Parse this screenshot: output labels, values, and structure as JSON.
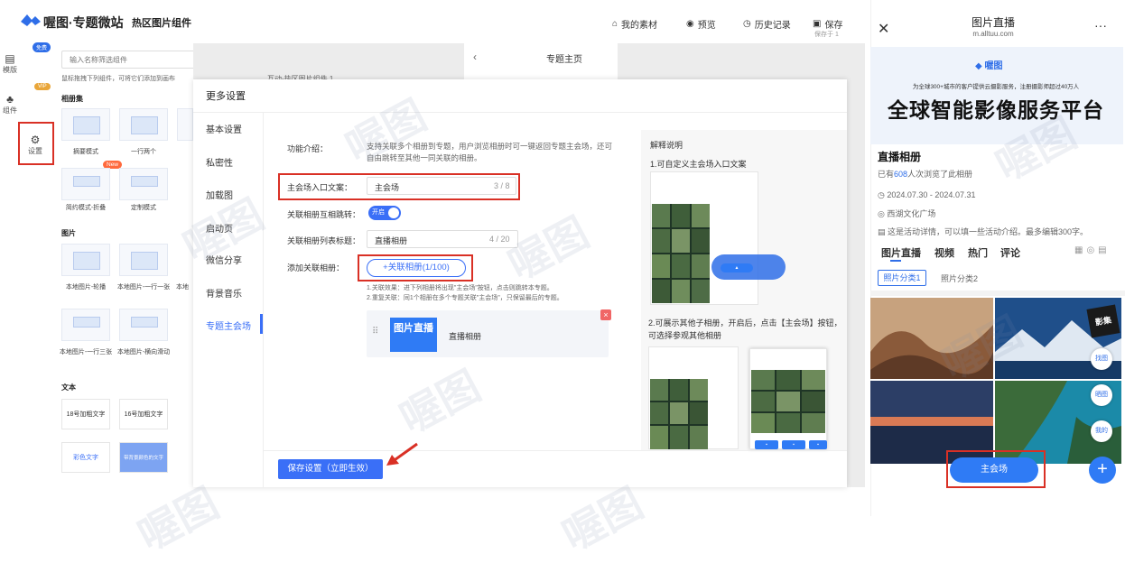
{
  "header": {
    "brand": "喔图·专题微站",
    "subtitle": "热区图片组件",
    "my_assets": "我的素材",
    "preview": "预览",
    "history": "历史记录",
    "save": "保存",
    "save_sub": "保存于 1"
  },
  "rail": {
    "free_badge": "免费",
    "template": "模版",
    "vip_badge": "VIP",
    "components": "组件",
    "settings": "设置"
  },
  "components": {
    "search_placeholder": "输入名称筛选组件",
    "hint": "鼠标拖拽下列组件，可将它们添加到画布",
    "album_section": "相册集",
    "album_items": [
      "摘要模式",
      "一行两个",
      "简约模式-折叠",
      "定制模式"
    ],
    "new_badge": "New",
    "image_section": "图片",
    "image_items": [
      "本地图片-轮播",
      "本地图片-一行一张",
      "本地图片-一行三张",
      "本地图片-横向滑动",
      "本地"
    ],
    "text_section": "文本",
    "text_items": [
      "18号加粗文字",
      "16号加粗文字",
      "彩色文字",
      "带背景颜色的文字"
    ]
  },
  "canvas": {
    "page_title": "专题主页",
    "hotspot_label": "互动-热区图片组件 1"
  },
  "modal": {
    "title": "更多设置",
    "nav": [
      "基本设置",
      "私密性",
      "加载图",
      "启动页",
      "微信分享",
      "背景音乐",
      "专题主会场"
    ],
    "intro_label": "功能介绍：",
    "intro_text": "支持关联多个相册到专题，用户浏览相册时可一键返回专题主会场，还可自由跳转至其他一同关联的相册。",
    "entry_label": "主会场入口文案：",
    "entry_value": "主会场",
    "entry_count": "3 / 8",
    "mutual_label": "关联相册互相跳转：",
    "toggle_text": "开启",
    "list_title_label": "关联相册列表标题：",
    "list_title_value": "直播相册",
    "list_title_count": "4 / 20",
    "add_label": "添加关联相册：",
    "add_button": "+关联相册(1/100)",
    "note1": "1.关联效果：进下列相册将出现\"主会场\"按钮，点击则跳转本专题。",
    "note2": "2.重复关联：同1个相册在多个专题关联\"主会场\"，只保留最后的专题。",
    "album_thumb_text": "图片直播",
    "album_name": "直播相册",
    "remove": "×",
    "explain_title": "解释说明",
    "explain_1": "1.可自定义主会场入口文案",
    "explain_2": "2.可展示其他子相册，开启后，点击【主会场】按钮，可选择参观其他相册",
    "save_button": "保存设置（立即生效）"
  },
  "mobile": {
    "title": "图片直播",
    "url": "m.alltuu.com",
    "banner_logo": "喔图",
    "banner_sub": "为全球300+城市的客户提供云摄影服务，注册摄影师超过40万人",
    "banner_main": "全球智能影像服务平台",
    "album_title": "直播相册",
    "viewers_prefix": "已有",
    "viewers_count": "608",
    "viewers_suffix": "人次浏览了此相册",
    "date": "2024.07.30 - 2024.07.31",
    "location": "西湖文化广场",
    "desc": "这是活动详情，可以填一些活动介绍。最多编辑300字。",
    "tabs": [
      "图片直播",
      "视频",
      "热门",
      "评论"
    ],
    "sub_tabs": [
      "照片分类1",
      "照片分类2"
    ],
    "side_buttons": [
      "影集",
      "找图",
      "晒图",
      "我的"
    ],
    "main_button": "主会场",
    "fab": "+"
  },
  "watermark": "喔图",
  "colors": {
    "accent": "#3a6ff7",
    "highlight": "#d93025"
  }
}
